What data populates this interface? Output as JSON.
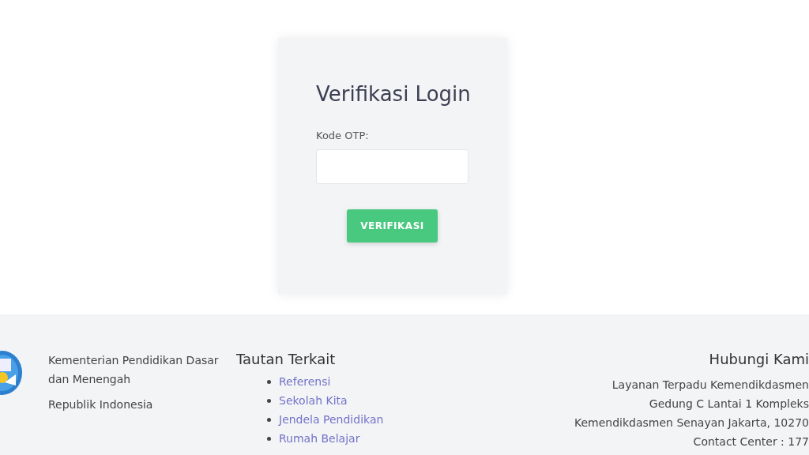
{
  "login": {
    "title": "Verifikasi Login",
    "otp_label": "Kode OTP:",
    "button": "VERIFIKASI"
  },
  "footer": {
    "org_lines": [
      "Kementerian Pendidikan Dasar dan Menengah",
      "Republik Indonesia"
    ],
    "links_title": "Tautan Terkait",
    "links": [
      "Referensi",
      "Sekolah Kita",
      "Jendela Pendidikan",
      "Rumah Belajar"
    ],
    "contact_title": "Hubungi Kami",
    "contact_lines": [
      "Layanan Terpadu Kemendikdasmen",
      "Gedung C Lantai 1 Kompleks",
      "Kemendikdasmen Senayan Jakarta, 10270",
      "Contact Center : 177"
    ]
  }
}
